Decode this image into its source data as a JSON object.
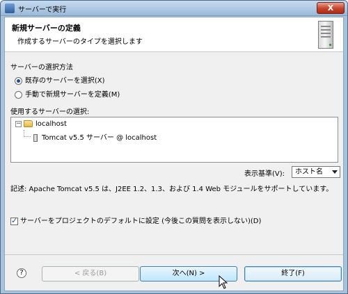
{
  "window": {
    "title": "サーバーで実行",
    "close_label": "X"
  },
  "header": {
    "title": "新規サーバーの定義",
    "subtitle": "作成するサーバーのタイプを選択します",
    "icon": "server-icon"
  },
  "selection": {
    "label": "サーバーの選択方法",
    "options": [
      {
        "label": "既存のサーバーを選択(X)",
        "selected": true
      },
      {
        "label": "手動で新規サーバーを定義(M)",
        "selected": false
      }
    ]
  },
  "server_tree": {
    "label": "使用するサーバーの選択:",
    "items": [
      {
        "label": "localhost",
        "icon": "folder-icon",
        "expanded": true
      },
      {
        "label": "Tomcat v5.5 サーバー @ localhost",
        "icon": "server-icon"
      }
    ]
  },
  "view_by": {
    "label": "表示基準(V):",
    "value": "ホスト名"
  },
  "description": "記述: Apache Tomcat v5.5 は、J2EE 1.2、1.3、および 1.4 Web モジュールをサポートしています。",
  "default_checkbox": {
    "label": "サーバーをプロジェクトのデフォルトに設定 (今後この質問を表示しない)(D)",
    "checked": true
  },
  "buttons": {
    "help": "?",
    "back": "< 戻る(B)",
    "next": "次へ(N) >",
    "finish": "終了(F)"
  }
}
